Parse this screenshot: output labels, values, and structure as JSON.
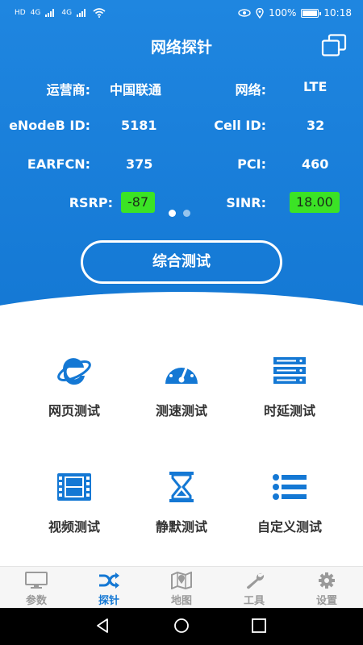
{
  "status_bar": {
    "left_indicators": [
      "HD",
      "4G",
      "4G"
    ],
    "battery": "100%",
    "time": "10:18"
  },
  "header": {
    "title": "网络探针"
  },
  "info": {
    "operator_label": "运营商:",
    "operator_value": "中国联通",
    "network_label": "网络:",
    "network_value": "LTE",
    "enodeb_label": "eNodeB ID:",
    "enodeb_value": "5181",
    "cellid_label": "Cell ID:",
    "cellid_value": "32",
    "earfcn_label": "EARFCN:",
    "earfcn_value": "375",
    "pci_label": "PCI:",
    "pci_value": "460",
    "rsrp_label": "RSRP:",
    "rsrp_value": "-87",
    "sinr_label": "SINR:",
    "sinr_value": "18.00"
  },
  "main_button": "综合测试",
  "functions": {
    "web": "网页测试",
    "speed": "测速测试",
    "latency": "时延测试",
    "video": "视频测试",
    "silent": "静默测试",
    "custom": "自定义测试"
  },
  "tabs": {
    "params": "参数",
    "probe": "探针",
    "map": "地图",
    "tools": "工具",
    "settings": "设置"
  },
  "colors": {
    "primary": "#1478d4",
    "badge": "#3be325",
    "tab_inactive": "#9a9a9a"
  }
}
